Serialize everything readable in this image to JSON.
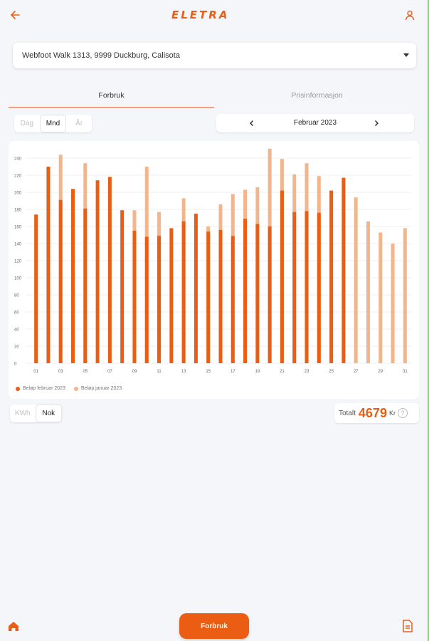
{
  "header": {
    "logo": "ELETRA",
    "back_icon": "arrow-left-icon",
    "user_icon": "user-icon"
  },
  "address": {
    "selected": "Webfoot Walk 1313, 9999 Duckburg, Calisota"
  },
  "tabs": [
    {
      "label": "Forbruk",
      "active": true
    },
    {
      "label": "Prisinformasjon",
      "active": false
    }
  ],
  "period": {
    "options": [
      "Dag",
      "Mnd",
      "År"
    ],
    "selected": "Mnd"
  },
  "date_nav": {
    "label": "Februar 2023"
  },
  "units": {
    "options": [
      "KWh",
      "Nok"
    ],
    "selected": "Nok"
  },
  "total": {
    "label": "Totalt",
    "value": "4679",
    "unit": "Kr"
  },
  "bottom_nav": {
    "center_label": "Forbruk"
  },
  "colors": {
    "accent": "#ec5d14",
    "light_series": "#f3b58c"
  },
  "chart_data": {
    "type": "bar",
    "overlay": true,
    "ylim": [
      0,
      240
    ],
    "yticks": [
      0,
      20,
      40,
      60,
      80,
      100,
      120,
      140,
      160,
      180,
      200,
      220,
      240
    ],
    "x": [
      "01",
      "02",
      "03",
      "04",
      "05",
      "06",
      "07",
      "08",
      "09",
      "10",
      "11",
      "12",
      "13",
      "14",
      "15",
      "16",
      "17",
      "18",
      "19",
      "20",
      "21",
      "22",
      "23",
      "24",
      "25",
      "26",
      "27",
      "28",
      "29",
      "30",
      "31"
    ],
    "xtick_labels": [
      "01",
      "03",
      "05",
      "07",
      "09",
      "11",
      "13",
      "15",
      "17",
      "19",
      "21",
      "23",
      "25",
      "27",
      "29",
      "31"
    ],
    "legend_position": "bottom-left",
    "series": [
      {
        "name": "Beløp februar 2023",
        "color": "#ec5d14",
        "values": [
          174,
          230,
          191,
          204,
          181,
          214,
          218,
          179,
          155,
          148,
          149,
          158,
          166,
          175,
          154,
          156,
          149,
          169,
          163,
          160,
          202,
          177,
          178,
          176,
          202,
          217,
          null,
          null,
          null,
          null,
          null
        ]
      },
      {
        "name": "Beløp januar 2023",
        "color": "#f3b58c",
        "values": [
          null,
          null,
          244,
          null,
          234,
          null,
          null,
          null,
          179,
          230,
          177,
          null,
          193,
          null,
          160,
          186,
          198,
          203,
          206,
          251,
          239,
          221,
          234,
          219,
          null,
          null,
          194,
          166,
          153,
          140,
          158
        ]
      }
    ]
  }
}
